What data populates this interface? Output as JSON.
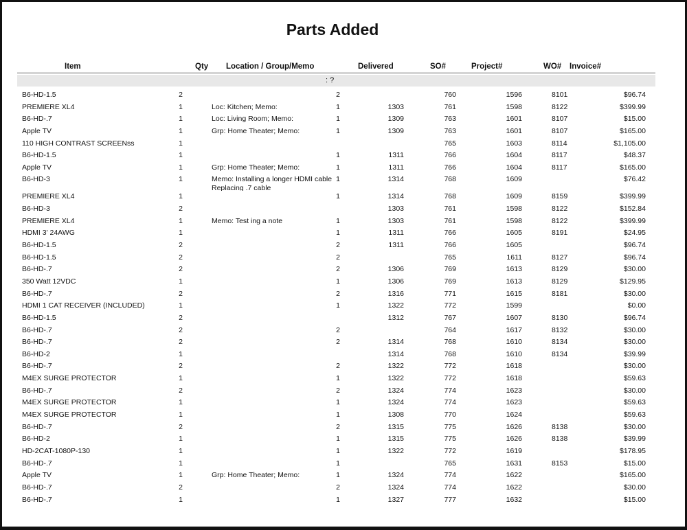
{
  "report": {
    "title": "Parts Added",
    "headers": [
      "Item",
      "Qty",
      "Location / Group/Memo",
      "Delivered",
      "SO#",
      "Project#",
      "WO#",
      "Invoice#"
    ],
    "group_label": ": ?",
    "rows": [
      [
        "B6-HD-1.5",
        "2",
        "",
        "2",
        "",
        "760",
        "1596",
        "8101",
        "$96.74"
      ],
      [
        "PREMIERE XL4",
        "1",
        "Loc: Kitchen; Memo:",
        "1",
        "1303",
        "761",
        "1598",
        "8122",
        "$399.99"
      ],
      [
        "B6-HD-.7",
        "1",
        "Loc: Living Room; Memo:",
        "1",
        "1309",
        "763",
        "1601",
        "8107",
        "$15.00"
      ],
      [
        "Apple TV",
        "1",
        "Grp: Home Theater; Memo:",
        "1",
        "1309",
        "763",
        "1601",
        "8107",
        "$165.00"
      ],
      [
        "110 HIGH CONTRAST SCREENss",
        "1",
        "",
        "",
        "",
        "765",
        "1603",
        "8114",
        "$1,105.00"
      ],
      [
        "B6-HD-1.5",
        "1",
        "",
        "1",
        "1311",
        "766",
        "1604",
        "8117",
        "$48.37"
      ],
      [
        "Apple TV",
        "1",
        "Grp: Home Theater; Memo:",
        "1",
        "1311",
        "766",
        "1604",
        "8117",
        "$165.00"
      ],
      [
        "B6-HD-3",
        "1",
        "Memo: Installing a longer HDMI cable Replacing .7 cable",
        "1",
        "1314",
        "768",
        "1609",
        "",
        "$76.42"
      ],
      [
        "PREMIERE XL4",
        "1",
        "",
        "1",
        "1314",
        "768",
        "1609",
        "8159",
        "$399.99"
      ],
      [
        "B6-HD-3",
        "2",
        "",
        "",
        "1303",
        "761",
        "1598",
        "8122",
        "$152.84"
      ],
      [
        "PREMIERE XL4",
        "1",
        "Memo: Test ing a note",
        "1",
        "1303",
        "761",
        "1598",
        "8122",
        "$399.99"
      ],
      [
        "HDMI 3'  24AWG",
        "1",
        "",
        "1",
        "1311",
        "766",
        "1605",
        "8191",
        "$24.95"
      ],
      [
        "B6-HD-1.5",
        "2",
        "",
        "2",
        "1311",
        "766",
        "1605",
        "",
        "$96.74"
      ],
      [
        "B6-HD-1.5",
        "2",
        "",
        "2",
        "",
        "765",
        "1611",
        "8127",
        "$96.74"
      ],
      [
        "B6-HD-.7",
        "2",
        "",
        "2",
        "1306",
        "769",
        "1613",
        "8129",
        "$30.00"
      ],
      [
        "350 Watt 12VDC",
        "1",
        "",
        "1",
        "1306",
        "769",
        "1613",
        "8129",
        "$129.95"
      ],
      [
        "B6-HD-.7",
        "2",
        "",
        "2",
        "1316",
        "771",
        "1615",
        "8181",
        "$30.00"
      ],
      [
        "HDMI 1 CAT RECEIVER (INCLUDED)",
        "1",
        "",
        "1",
        "1322",
        "772",
        "1599",
        "",
        "$0.00"
      ],
      [
        "B6-HD-1.5",
        "2",
        "",
        "",
        "1312",
        "767",
        "1607",
        "8130",
        "$96.74"
      ],
      [
        "B6-HD-.7",
        "2",
        "",
        "2",
        "",
        "764",
        "1617",
        "8132",
        "$30.00"
      ],
      [
        "B6-HD-.7",
        "2",
        "",
        "2",
        "1314",
        "768",
        "1610",
        "8134",
        "$30.00"
      ],
      [
        "B6-HD-2",
        "1",
        "",
        "",
        "1314",
        "768",
        "1610",
        "8134",
        "$39.99"
      ],
      [
        "B6-HD-.7",
        "2",
        "",
        "2",
        "1322",
        "772",
        "1618",
        "",
        "$30.00"
      ],
      [
        "M4EX SURGE PROTECTOR",
        "1",
        "",
        "1",
        "1322",
        "772",
        "1618",
        "",
        "$59.63"
      ],
      [
        "B6-HD-.7",
        "2",
        "",
        "2",
        "1324",
        "774",
        "1623",
        "",
        "$30.00"
      ],
      [
        "M4EX SURGE PROTECTOR",
        "1",
        "",
        "1",
        "1324",
        "774",
        "1623",
        "",
        "$59.63"
      ],
      [
        "M4EX SURGE PROTECTOR",
        "1",
        "",
        "1",
        "1308",
        "770",
        "1624",
        "",
        "$59.63"
      ],
      [
        "B6-HD-.7",
        "2",
        "",
        "2",
        "1315",
        "775",
        "1626",
        "8138",
        "$30.00"
      ],
      [
        "B6-HD-2",
        "1",
        "",
        "1",
        "1315",
        "775",
        "1626",
        "8138",
        "$39.99"
      ],
      [
        "HD-2CAT-1080P-130",
        "1",
        "",
        "1",
        "1322",
        "772",
        "1619",
        "",
        "$178.95"
      ],
      [
        "B6-HD-.7",
        "1",
        "",
        "1",
        "",
        "765",
        "1631",
        "8153",
        "$15.00"
      ],
      [
        "Apple TV",
        "1",
        "Grp: Home Theater; Memo:",
        "1",
        "1324",
        "774",
        "1622",
        "",
        "$165.00"
      ],
      [
        "B6-HD-.7",
        "2",
        "",
        "2",
        "1324",
        "774",
        "1622",
        "",
        "$30.00"
      ],
      [
        "B6-HD-.7",
        "1",
        "",
        "1",
        "1327",
        "777",
        "1632",
        "",
        "$15.00"
      ]
    ]
  }
}
